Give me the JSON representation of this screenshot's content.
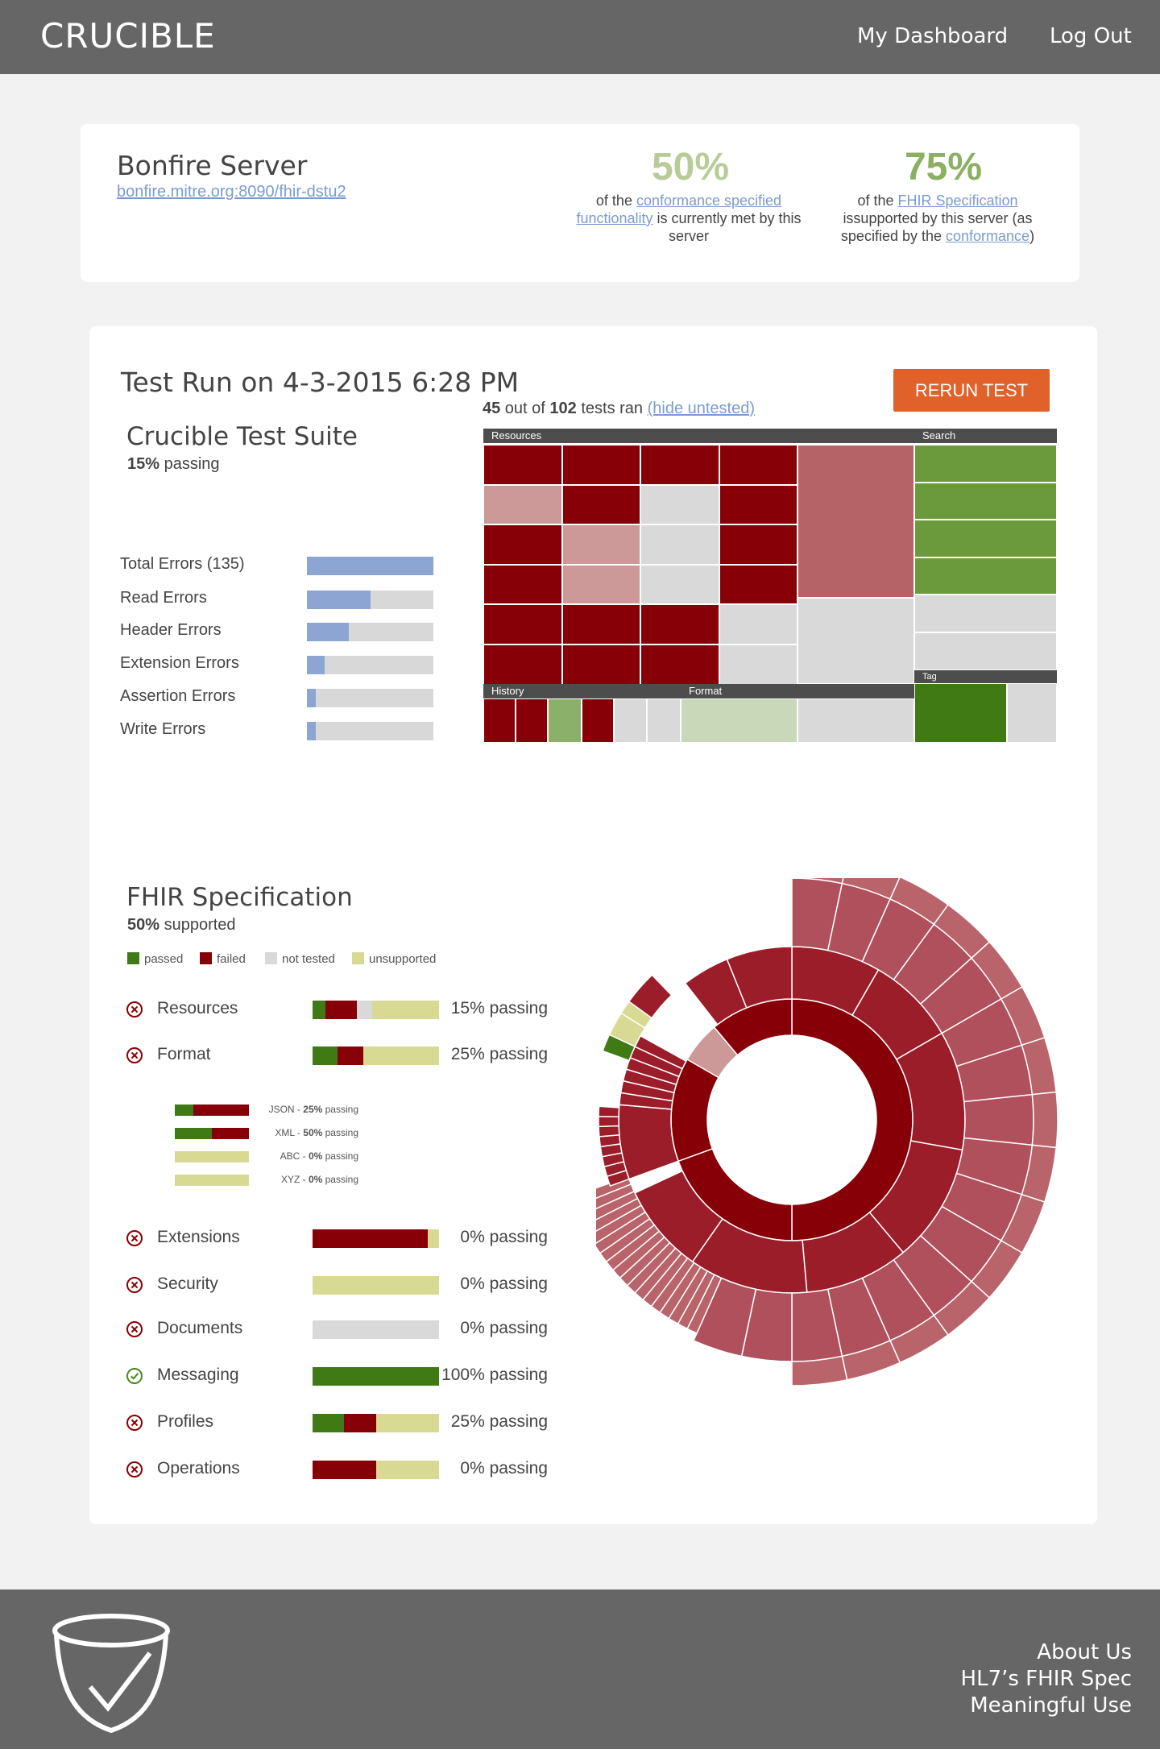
{
  "header": {
    "app_name": "CRUCIBLE",
    "nav_dashboard": "My Dashboard",
    "nav_logout": "Log Out"
  },
  "server": {
    "name": "Bonfire Server",
    "url": "bonfire.mitre.org:8090/fhir-dstu2",
    "stat1": {
      "value": "50%",
      "pre": "of the ",
      "link": "conformance specified functionality",
      "post": " is currently met by this server"
    },
    "stat2": {
      "value": "75%",
      "pre": "of the ",
      "link": "FHIR Specification",
      "mid": " issupported by this server (as specified by the ",
      "link2": "conformance",
      "post": ")"
    }
  },
  "test_run": {
    "title": "Test Run on 4-3-2015 6:28 PM",
    "rerun_label": "RERUN TEST",
    "tests_ran_count": "45",
    "tests_ran_mid": " out of ",
    "tests_total": "102",
    "tests_ran_post": " tests ran ",
    "hide_untested": "(hide untested)",
    "suite_title": "Crucible Test Suite",
    "suite_pct": "15%",
    "suite_pass_label": " passing",
    "errors": [
      {
        "label": "Total Errors (135)",
        "fraction": 1.0
      },
      {
        "label": "Read Errors",
        "fraction": 0.5
      },
      {
        "label": "Header Errors",
        "fraction": 0.33
      },
      {
        "label": "Extension Errors",
        "fraction": 0.14
      },
      {
        "label": "Assertion Errors",
        "fraction": 0.07
      },
      {
        "label": "Write Errors",
        "fraction": 0.07
      }
    ],
    "treemap_labels": {
      "resources": "Resources",
      "search": "Search",
      "history": "History",
      "format": "Format",
      "tag": "Tag"
    }
  },
  "spec": {
    "title": "FHIR Specification",
    "pct": "50%",
    "supported_label": " supported",
    "legend": {
      "passed": "passed",
      "failed": "failed",
      "not_tested": "not tested",
      "unsupported": "unsupported"
    },
    "colors": {
      "passed": "#3f7a14",
      "failed": "#870008",
      "not_tested": "#d9d9d9",
      "unsupported": "#d8da94"
    },
    "categories": [
      {
        "label": "Resources",
        "status": "fail",
        "pct_text": "15% passing",
        "segments": {
          "passed": 0.1,
          "failed": 0.25,
          "not_tested": 0.12,
          "unsupported": 0.53
        }
      },
      {
        "label": "Format",
        "status": "fail",
        "pct_text": "25% passing",
        "segments": {
          "passed": 0.2,
          "failed": 0.2,
          "not_tested": 0,
          "unsupported": 0.6
        }
      },
      {
        "label": "Extensions",
        "status": "fail",
        "pct_text": "0% passing",
        "segments": {
          "passed": 0,
          "failed": 0.91,
          "not_tested": 0,
          "unsupported": 0.09
        }
      },
      {
        "label": "Security",
        "status": "fail",
        "pct_text": "0% passing",
        "segments": {
          "passed": 0,
          "failed": 0,
          "not_tested": 0,
          "unsupported": 1
        }
      },
      {
        "label": "Documents",
        "status": "fail",
        "pct_text": "0% passing",
        "segments": {
          "passed": 0,
          "failed": 0,
          "not_tested": 1,
          "unsupported": 0
        }
      },
      {
        "label": "Messaging",
        "status": "pass",
        "pct_text": "100% passing",
        "segments": {
          "passed": 1,
          "failed": 0,
          "not_tested": 0,
          "unsupported": 0
        }
      },
      {
        "label": "Profiles",
        "status": "fail",
        "pct_text": "25% passing",
        "segments": {
          "passed": 0.25,
          "failed": 0.25,
          "not_tested": 0,
          "unsupported": 0.5
        }
      },
      {
        "label": "Operations",
        "status": "fail",
        "pct_text": "0% passing",
        "segments": {
          "passed": 0,
          "failed": 0.5,
          "not_tested": 0,
          "unsupported": 0.5
        }
      }
    ],
    "formats": [
      {
        "name": "JSON",
        "pct": "25%",
        "segments": {
          "passed": 0.25,
          "failed": 0.75,
          "unsupported": 0
        }
      },
      {
        "name": "XML",
        "pct": "50%",
        "segments": {
          "passed": 0.5,
          "failed": 0.5,
          "unsupported": 0
        }
      },
      {
        "name": "ABC",
        "pct": "0%",
        "segments": {
          "passed": 0,
          "failed": 0,
          "unsupported": 1
        }
      },
      {
        "name": "XYZ",
        "pct": "0%",
        "segments": {
          "passed": 0,
          "failed": 0,
          "unsupported": 1
        }
      }
    ],
    "format_sep": " - ",
    "format_passing": " passing"
  },
  "footer": {
    "about": "About Us",
    "hl7": "HL7’s FHIR Spec",
    "meaningful": "Meaningful Use"
  }
}
